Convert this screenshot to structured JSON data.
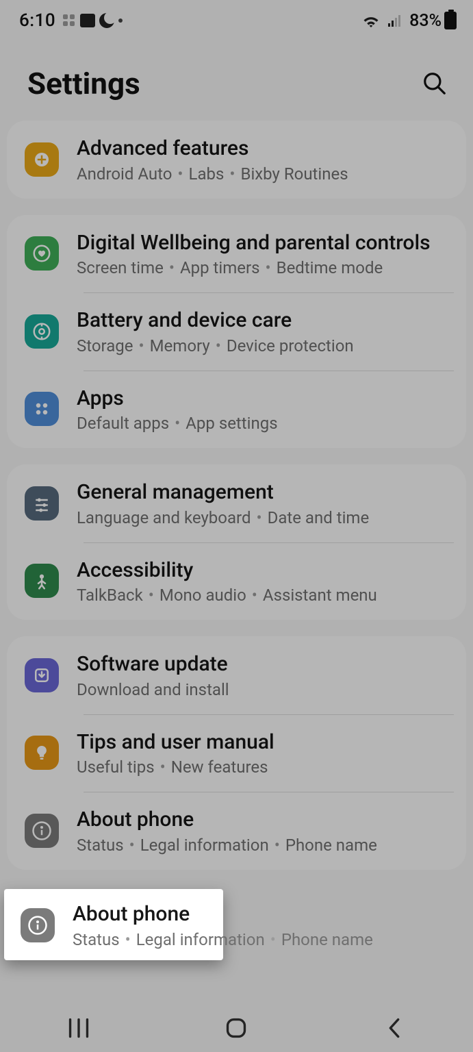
{
  "status": {
    "time": "6:10",
    "battery_pct": "83%"
  },
  "header": {
    "title": "Settings"
  },
  "groups": [
    {
      "items": [
        {
          "id": "advanced-features",
          "icon": "plus-gear-icon",
          "color": "c-orange",
          "title": "Advanced features",
          "subs": [
            "Android Auto",
            "Labs",
            "Bixby Routines"
          ]
        }
      ]
    },
    {
      "items": [
        {
          "id": "digital-wellbeing",
          "icon": "heart-ring-icon",
          "color": "c-green",
          "title": "Digital Wellbeing and parental controls",
          "subs": [
            "Screen time",
            "App timers",
            "Bedtime mode"
          ]
        },
        {
          "id": "battery-care",
          "icon": "device-care-icon",
          "color": "c-teal",
          "title": "Battery and device care",
          "subs": [
            "Storage",
            "Memory",
            "Device protection"
          ]
        },
        {
          "id": "apps",
          "icon": "apps-grid-icon",
          "color": "c-blue",
          "title": "Apps",
          "subs": [
            "Default apps",
            "App settings"
          ]
        }
      ]
    },
    {
      "items": [
        {
          "id": "general-management",
          "icon": "sliders-icon",
          "color": "c-slate",
          "title": "General management",
          "subs": [
            "Language and keyboard",
            "Date and time"
          ]
        },
        {
          "id": "accessibility",
          "icon": "person-icon",
          "color": "c-dgreen",
          "title": "Accessibility",
          "subs": [
            "TalkBack",
            "Mono audio",
            "Assistant menu"
          ]
        }
      ]
    },
    {
      "items": [
        {
          "id": "software-update",
          "icon": "update-icon",
          "color": "c-purple",
          "title": "Software update",
          "subs": [
            "Download and install"
          ]
        },
        {
          "id": "tips",
          "icon": "bulb-icon",
          "color": "c-orange2",
          "title": "Tips and user manual",
          "subs": [
            "Useful tips",
            "New features"
          ]
        },
        {
          "id": "about-phone",
          "icon": "info-icon",
          "color": "c-gray",
          "title": "About phone",
          "subs": [
            "Status",
            "Legal information",
            "Phone name"
          ]
        }
      ]
    }
  ],
  "highlight": {
    "title": "About phone",
    "subs": [
      "Status",
      "Legal information",
      "Phone name"
    ]
  }
}
